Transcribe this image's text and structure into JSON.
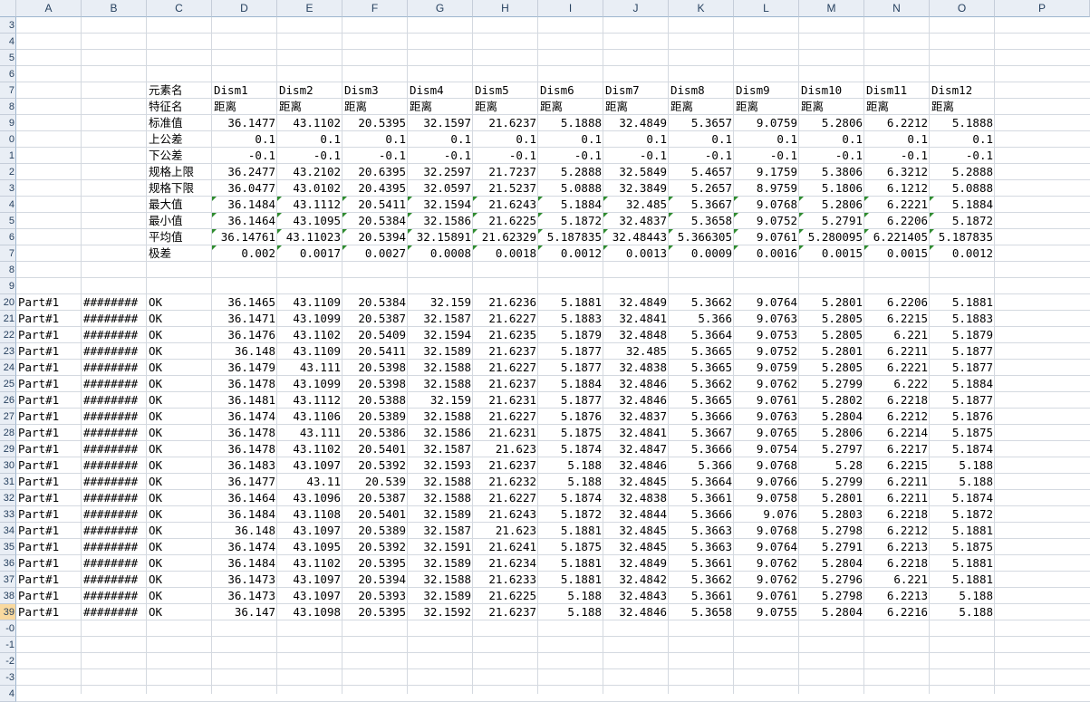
{
  "columns": [
    "A",
    "B",
    "C",
    "D",
    "E",
    "F",
    "G",
    "H",
    "I",
    "J",
    "K",
    "L",
    "M",
    "N",
    "O",
    "P"
  ],
  "row_numbers": [
    "3",
    "4",
    "5",
    "6",
    "7",
    "8",
    "9",
    "0",
    "1",
    "2",
    "3",
    "4",
    "5",
    "6",
    "7",
    "8",
    "9",
    "20",
    "21",
    "22",
    "23",
    "24",
    "25",
    "26",
    "27",
    "28",
    "29",
    "30",
    "31",
    "32",
    "33",
    "34",
    "35",
    "36",
    "37",
    "38",
    "39",
    "-0",
    "-1",
    "-2",
    "-3",
    "4"
  ],
  "selected_row": "39",
  "header_rows": [
    {
      "row": "7",
      "label": "元素名",
      "values": [
        "Dism1",
        "Dism2",
        "Dism3",
        "Dism4",
        "Dism5",
        "Dism6",
        "Dism7",
        "Dism8",
        "Dism9",
        "Dism10",
        "Dism11",
        "Dism12"
      ]
    },
    {
      "row": "8",
      "label": "特征名",
      "values": [
        "距离",
        "距离",
        "距离",
        "距离",
        "距离",
        "距离",
        "距离",
        "距离",
        "距离",
        "距离",
        "距离",
        "距离"
      ]
    }
  ],
  "stat_rows": [
    {
      "row": "9",
      "label": "标准值",
      "values": [
        "36.1477",
        "43.1102",
        "20.5395",
        "32.1597",
        "21.6237",
        "5.1888",
        "32.4849",
        "5.3657",
        "9.0759",
        "5.2806",
        "6.2212",
        "5.1888"
      ]
    },
    {
      "row": "0",
      "label": "上公差",
      "values": [
        "0.1",
        "0.1",
        "0.1",
        "0.1",
        "0.1",
        "0.1",
        "0.1",
        "0.1",
        "0.1",
        "0.1",
        "0.1",
        "0.1"
      ]
    },
    {
      "row": "1",
      "label": "下公差",
      "values": [
        "-0.1",
        "-0.1",
        "-0.1",
        "-0.1",
        "-0.1",
        "-0.1",
        "-0.1",
        "-0.1",
        "-0.1",
        "-0.1",
        "-0.1",
        "-0.1"
      ]
    },
    {
      "row": "2",
      "label": "规格上限",
      "values": [
        "36.2477",
        "43.2102",
        "20.6395",
        "32.2597",
        "21.7237",
        "5.2888",
        "32.5849",
        "5.4657",
        "9.1759",
        "5.3806",
        "6.3212",
        "5.2888"
      ]
    },
    {
      "row": "3",
      "label": "规格下限",
      "values": [
        "36.0477",
        "43.0102",
        "20.4395",
        "32.0597",
        "21.5237",
        "5.0888",
        "32.3849",
        "5.2657",
        "8.9759",
        "5.1806",
        "6.1212",
        "5.0888"
      ]
    },
    {
      "row": "4",
      "label": "最大值",
      "flag": true,
      "values": [
        "36.1484",
        "43.1112",
        "20.5411",
        "32.1594",
        "21.6243",
        "5.1884",
        "32.485",
        "5.3667",
        "9.0768",
        "5.2806",
        "6.2221",
        "5.1884"
      ]
    },
    {
      "row": "5",
      "label": "最小值",
      "flag": true,
      "values": [
        "36.1464",
        "43.1095",
        "20.5384",
        "32.1586",
        "21.6225",
        "5.1872",
        "32.4837",
        "5.3658",
        "9.0752",
        "5.2791",
        "6.2206",
        "5.1872"
      ]
    },
    {
      "row": "6",
      "label": "平均值",
      "flag": true,
      "values": [
        "36.14761",
        "43.11023",
        "20.5394",
        "32.15891",
        "21.62329",
        "5.187835",
        "32.48443",
        "5.366305",
        "9.0761",
        "5.280095",
        "6.221405",
        "5.187835"
      ]
    },
    {
      "row": "7",
      "label": "极差",
      "flag": true,
      "values": [
        "0.002",
        "0.0017",
        "0.0027",
        "0.0008",
        "0.0018",
        "0.0012",
        "0.0013",
        "0.0009",
        "0.0016",
        "0.0015",
        "0.0015",
        "0.0012"
      ]
    }
  ],
  "data_rows": [
    {
      "row": "20",
      "part": "Part#1",
      "date": "########",
      "result": "OK",
      "values": [
        "36.1465",
        "43.1109",
        "20.5384",
        "32.159",
        "21.6236",
        "5.1881",
        "32.4849",
        "5.3662",
        "9.0764",
        "5.2801",
        "6.2206",
        "5.1881"
      ]
    },
    {
      "row": "21",
      "part": "Part#1",
      "date": "########",
      "result": "OK",
      "values": [
        "36.1471",
        "43.1099",
        "20.5387",
        "32.1587",
        "21.6227",
        "5.1883",
        "32.4841",
        "5.366",
        "9.0763",
        "5.2805",
        "6.2215",
        "5.1883"
      ]
    },
    {
      "row": "22",
      "part": "Part#1",
      "date": "########",
      "result": "OK",
      "values": [
        "36.1476",
        "43.1102",
        "20.5409",
        "32.1594",
        "21.6235",
        "5.1879",
        "32.4848",
        "5.3664",
        "9.0753",
        "5.2805",
        "6.221",
        "5.1879"
      ]
    },
    {
      "row": "23",
      "part": "Part#1",
      "date": "########",
      "result": "OK",
      "values": [
        "36.148",
        "43.1109",
        "20.5411",
        "32.1589",
        "21.6237",
        "5.1877",
        "32.485",
        "5.3665",
        "9.0752",
        "5.2801",
        "6.2211",
        "5.1877"
      ]
    },
    {
      "row": "24",
      "part": "Part#1",
      "date": "########",
      "result": "OK",
      "values": [
        "36.1479",
        "43.111",
        "20.5398",
        "32.1588",
        "21.6227",
        "5.1877",
        "32.4838",
        "5.3665",
        "9.0759",
        "5.2805",
        "6.2221",
        "5.1877"
      ]
    },
    {
      "row": "25",
      "part": "Part#1",
      "date": "########",
      "result": "OK",
      "values": [
        "36.1478",
        "43.1099",
        "20.5398",
        "32.1588",
        "21.6237",
        "5.1884",
        "32.4846",
        "5.3662",
        "9.0762",
        "5.2799",
        "6.222",
        "5.1884"
      ]
    },
    {
      "row": "26",
      "part": "Part#1",
      "date": "########",
      "result": "OK",
      "values": [
        "36.1481",
        "43.1112",
        "20.5388",
        "32.159",
        "21.6231",
        "5.1877",
        "32.4846",
        "5.3665",
        "9.0761",
        "5.2802",
        "6.2218",
        "5.1877"
      ]
    },
    {
      "row": "27",
      "part": "Part#1",
      "date": "########",
      "result": "OK",
      "values": [
        "36.1474",
        "43.1106",
        "20.5389",
        "32.1588",
        "21.6227",
        "5.1876",
        "32.4837",
        "5.3666",
        "9.0763",
        "5.2804",
        "6.2212",
        "5.1876"
      ]
    },
    {
      "row": "28",
      "part": "Part#1",
      "date": "########",
      "result": "OK",
      "values": [
        "36.1478",
        "43.111",
        "20.5386",
        "32.1586",
        "21.6231",
        "5.1875",
        "32.4841",
        "5.3667",
        "9.0765",
        "5.2806",
        "6.2214",
        "5.1875"
      ]
    },
    {
      "row": "29",
      "part": "Part#1",
      "date": "########",
      "result": "OK",
      "values": [
        "36.1478",
        "43.1102",
        "20.5401",
        "32.1587",
        "21.623",
        "5.1874",
        "32.4847",
        "5.3666",
        "9.0754",
        "5.2797",
        "6.2217",
        "5.1874"
      ]
    },
    {
      "row": "30",
      "part": "Part#1",
      "date": "########",
      "result": "OK",
      "values": [
        "36.1483",
        "43.1097",
        "20.5392",
        "32.1593",
        "21.6237",
        "5.188",
        "32.4846",
        "5.366",
        "9.0768",
        "5.28",
        "6.2215",
        "5.188"
      ]
    },
    {
      "row": "31",
      "part": "Part#1",
      "date": "########",
      "result": "OK",
      "values": [
        "36.1477",
        "43.11",
        "20.539",
        "32.1588",
        "21.6232",
        "5.188",
        "32.4845",
        "5.3664",
        "9.0766",
        "5.2799",
        "6.2211",
        "5.188"
      ]
    },
    {
      "row": "32",
      "part": "Part#1",
      "date": "########",
      "result": "OK",
      "values": [
        "36.1464",
        "43.1096",
        "20.5387",
        "32.1588",
        "21.6227",
        "5.1874",
        "32.4838",
        "5.3661",
        "9.0758",
        "5.2801",
        "6.2211",
        "5.1874"
      ]
    },
    {
      "row": "33",
      "part": "Part#1",
      "date": "########",
      "result": "OK",
      "values": [
        "36.1484",
        "43.1108",
        "20.5401",
        "32.1589",
        "21.6243",
        "5.1872",
        "32.4844",
        "5.3666",
        "9.076",
        "5.2803",
        "6.2218",
        "5.1872"
      ]
    },
    {
      "row": "34",
      "part": "Part#1",
      "date": "########",
      "result": "OK",
      "values": [
        "36.148",
        "43.1097",
        "20.5389",
        "32.1587",
        "21.623",
        "5.1881",
        "32.4845",
        "5.3663",
        "9.0768",
        "5.2798",
        "6.2212",
        "5.1881"
      ]
    },
    {
      "row": "35",
      "part": "Part#1",
      "date": "########",
      "result": "OK",
      "values": [
        "36.1474",
        "43.1095",
        "20.5392",
        "32.1591",
        "21.6241",
        "5.1875",
        "32.4845",
        "5.3663",
        "9.0764",
        "5.2791",
        "6.2213",
        "5.1875"
      ]
    },
    {
      "row": "36",
      "part": "Part#1",
      "date": "########",
      "result": "OK",
      "values": [
        "36.1484",
        "43.1102",
        "20.5395",
        "32.1589",
        "21.6234",
        "5.1881",
        "32.4849",
        "5.3661",
        "9.0762",
        "5.2804",
        "6.2218",
        "5.1881"
      ]
    },
    {
      "row": "37",
      "part": "Part#1",
      "date": "########",
      "result": "OK",
      "values": [
        "36.1473",
        "43.1097",
        "20.5394",
        "32.1588",
        "21.6233",
        "5.1881",
        "32.4842",
        "5.3662",
        "9.0762",
        "5.2796",
        "6.221",
        "5.1881"
      ]
    },
    {
      "row": "38",
      "part": "Part#1",
      "date": "########",
      "result": "OK",
      "values": [
        "36.1473",
        "43.1097",
        "20.5393",
        "32.1589",
        "21.6225",
        "5.188",
        "32.4843",
        "5.3661",
        "9.0761",
        "5.2798",
        "6.2213",
        "5.188"
      ]
    },
    {
      "row": "39",
      "part": "Part#1",
      "date": "########",
      "result": "OK",
      "values": [
        "36.147",
        "43.1098",
        "20.5395",
        "32.1592",
        "21.6237",
        "5.188",
        "32.4846",
        "5.3658",
        "9.0755",
        "5.2804",
        "6.2216",
        "5.188"
      ]
    }
  ]
}
